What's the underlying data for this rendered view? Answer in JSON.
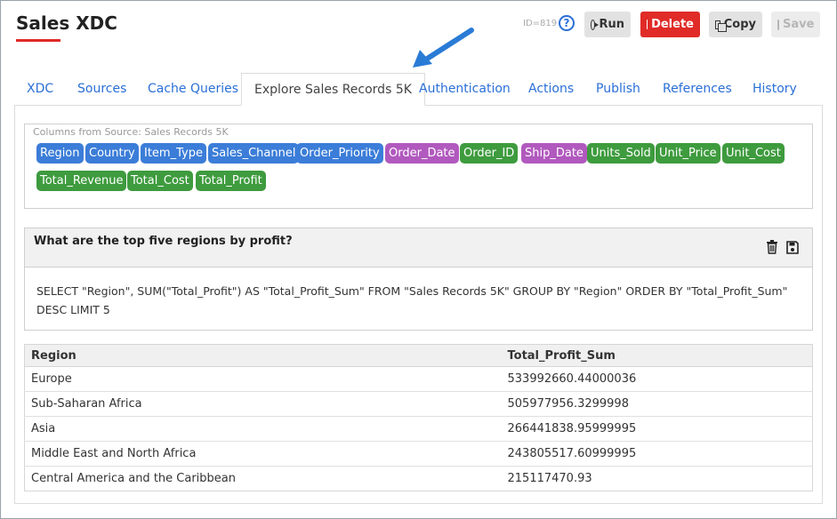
{
  "header": {
    "title": "Sales XDC",
    "id_label": "ID=819",
    "help": "?",
    "run_label": "Run",
    "delete_label": "Delete",
    "copy_label": "Copy",
    "save_label": "Save"
  },
  "tabs": [
    {
      "label": "XDC"
    },
    {
      "label": "Sources"
    },
    {
      "label": "Cache Queries"
    },
    {
      "label": "Explore Sales Records 5K",
      "active": true
    },
    {
      "label": "Authentication"
    },
    {
      "label": "Actions"
    },
    {
      "label": "Publish"
    },
    {
      "label": "References"
    },
    {
      "label": "History"
    }
  ],
  "columns_panel": {
    "caption": "Columns from Source: Sales Records 5K",
    "chips": [
      {
        "label": "Region",
        "color": "blue"
      },
      {
        "label": "Country",
        "color": "blue"
      },
      {
        "label": "Item_Type",
        "color": "blue"
      },
      {
        "label": "Sales_Channel",
        "color": "blue"
      },
      {
        "label": "Order_Priority",
        "color": "blue"
      },
      {
        "label": "Order_Date",
        "color": "purple"
      },
      {
        "label": "Order_ID",
        "color": "green"
      },
      {
        "label": "Ship_Date",
        "color": "purple"
      },
      {
        "label": "Units_Sold",
        "color": "green"
      },
      {
        "label": "Unit_Price",
        "color": "green"
      },
      {
        "label": "Unit_Cost",
        "color": "green"
      },
      {
        "label": "Total_Revenue",
        "color": "green"
      },
      {
        "label": "Total_Cost",
        "color": "green"
      },
      {
        "label": "Total_Profit",
        "color": "green"
      }
    ]
  },
  "query": {
    "title": "What are the top five regions by profit?",
    "sql": "SELECT \"Region\", SUM(\"Total_Profit\") AS \"Total_Profit_Sum\" FROM \"Sales Records 5K\" GROUP BY \"Region\" ORDER BY \"Total_Profit_Sum\" DESC LIMIT 5"
  },
  "results": {
    "headers": [
      "Region",
      "Total_Profit_Sum"
    ],
    "rows": [
      [
        "Europe",
        "533992660.44000036"
      ],
      [
        "Sub-Saharan Africa",
        "505977956.3299998"
      ],
      [
        "Asia",
        "266441838.95999995"
      ],
      [
        "Middle East and North Africa",
        "243805517.60999995"
      ],
      [
        "Central America and the Caribbean",
        "215117470.93"
      ]
    ]
  },
  "colors": {
    "accent": "#2a6fd6",
    "delete": "#e02b27",
    "chip_blue": "#3b7dd8",
    "chip_purple": "#b159be",
    "chip_green": "#3e9b3e"
  }
}
